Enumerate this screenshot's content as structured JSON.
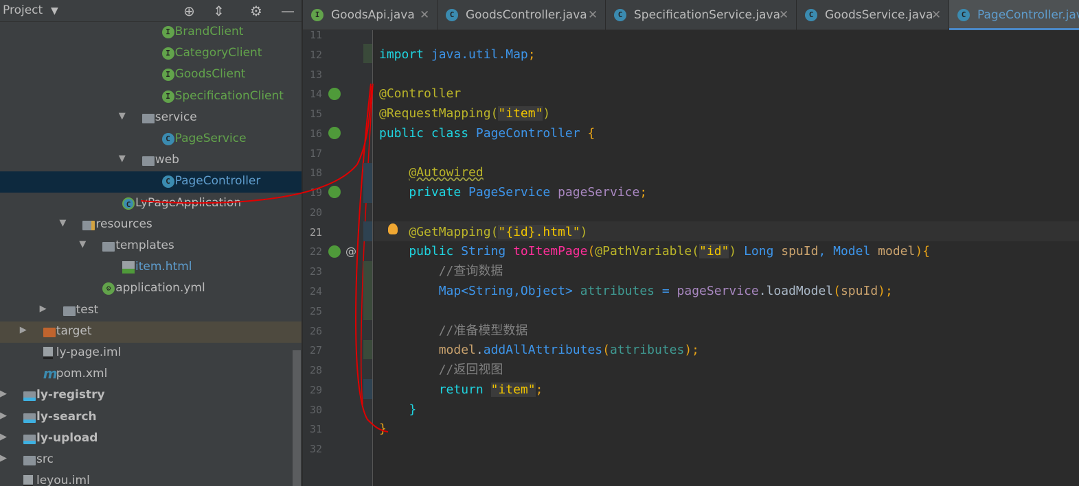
{
  "sidebar": {
    "title": "Project",
    "icons": [
      "locate-icon",
      "collapse-all-icon",
      "gear-icon",
      "minimize-icon"
    ],
    "items": [
      {
        "label": "BrandClient",
        "level": 7,
        "icon": "interface",
        "color": "green"
      },
      {
        "label": "CategoryClient",
        "level": 7,
        "icon": "interface",
        "color": "green"
      },
      {
        "label": "GoodsClient",
        "level": 7,
        "icon": "interface",
        "color": "green"
      },
      {
        "label": "SpecificationClient",
        "level": 7,
        "icon": "interface",
        "color": "green"
      },
      {
        "label": "service",
        "level": 6,
        "icon": "package",
        "arrow": "down"
      },
      {
        "label": "PageService",
        "level": 7,
        "icon": "class",
        "color": "green"
      },
      {
        "label": "web",
        "level": 6,
        "icon": "package",
        "arrow": "down"
      },
      {
        "label": "PageController",
        "level": 7,
        "icon": "class",
        "color": "blue",
        "selected": true
      },
      {
        "label": "LyPageApplication",
        "level": 5,
        "icon": "spring-boot-class"
      },
      {
        "label": "resources",
        "level": 3,
        "icon": "resources-folder",
        "arrow": "down"
      },
      {
        "label": "templates",
        "level": 4,
        "icon": "folder",
        "arrow": "down"
      },
      {
        "label": "item.html",
        "level": 5,
        "icon": "html-file",
        "color": "blue"
      },
      {
        "label": "application.yml",
        "level": 4,
        "icon": "spring-config"
      },
      {
        "label": "test",
        "level": 2,
        "icon": "folder",
        "arrow": "right"
      },
      {
        "label": "target",
        "level": 1,
        "icon": "excluded-folder",
        "arrow": "right",
        "highlight": true
      },
      {
        "label": "ly-page.iml",
        "level": 1,
        "icon": "iml-file"
      },
      {
        "label": "pom.xml",
        "level": 1,
        "icon": "maven"
      },
      {
        "label": "ly-registry",
        "level": 0,
        "icon": "module",
        "arrow": "right",
        "bold": true
      },
      {
        "label": "ly-search",
        "level": 0,
        "icon": "module",
        "arrow": "right",
        "bold": true
      },
      {
        "label": "ly-upload",
        "level": 0,
        "icon": "module",
        "arrow": "right",
        "bold": true
      },
      {
        "label": "src",
        "level": 0,
        "icon": "folder",
        "arrow": "right"
      },
      {
        "label": "leyou.iml",
        "level": 0,
        "icon": "iml-file"
      }
    ]
  },
  "tabs": [
    {
      "label": "GoodsApi.java",
      "icon": "interface"
    },
    {
      "label": "GoodsController.java",
      "icon": "class"
    },
    {
      "label": "SpecificationService.java",
      "icon": "class"
    },
    {
      "label": "GoodsService.java",
      "icon": "class"
    },
    {
      "label": "PageController.java",
      "icon": "class",
      "active": true
    }
  ],
  "editor": {
    "current_line": 21,
    "lines": [
      {
        "n": 11,
        "t": []
      },
      {
        "n": 12,
        "t": [
          [
            "import ",
            "kw"
          ],
          [
            "java.util.Map",
            "ty"
          ],
          [
            ";",
            "br"
          ]
        ]
      },
      {
        "n": 13,
        "t": []
      },
      {
        "n": 14,
        "t": [
          [
            "@Controller",
            "an"
          ]
        ]
      },
      {
        "n": 15,
        "t": [
          [
            "@RequestMapping(",
            "an"
          ],
          [
            "\"item\"",
            "st"
          ],
          [
            ")",
            "an"
          ]
        ]
      },
      {
        "n": 16,
        "t": [
          [
            "public class ",
            "kw"
          ],
          [
            "PageController ",
            "ty"
          ],
          [
            "{",
            "br"
          ]
        ]
      },
      {
        "n": 17,
        "t": []
      },
      {
        "n": 18,
        "t": [
          [
            "    ",
            ""
          ],
          [
            "@Autowired",
            "an ul"
          ]
        ]
      },
      {
        "n": 19,
        "t": [
          [
            "    private ",
            "kw"
          ],
          [
            "PageService ",
            "ty"
          ],
          [
            "pageService",
            "fd"
          ],
          [
            ";",
            "br"
          ]
        ]
      },
      {
        "n": 20,
        "t": []
      },
      {
        "n": 21,
        "t": [
          [
            "    ",
            ""
          ],
          [
            "@GetMapping(",
            "an"
          ],
          [
            "\"{id}.html\"",
            "st"
          ],
          [
            ")",
            "an"
          ]
        ]
      },
      {
        "n": 22,
        "t": [
          [
            "    public ",
            "kw"
          ],
          [
            "String ",
            "ty"
          ],
          [
            "toItemPage",
            "mt"
          ],
          [
            "(",
            "br"
          ],
          [
            "@PathVariable(",
            "an"
          ],
          [
            "\"id\"",
            "st"
          ],
          [
            ") ",
            "an"
          ],
          [
            "Long ",
            "ty"
          ],
          [
            "spuId",
            "pr"
          ],
          [
            ", ",
            "ty"
          ],
          [
            "Model ",
            "ty"
          ],
          [
            "model",
            "pr"
          ],
          [
            "){",
            "br"
          ]
        ]
      },
      {
        "n": 23,
        "t": [
          [
            "        //查询数据",
            "cm"
          ]
        ]
      },
      {
        "n": 24,
        "t": [
          [
            "        Map<",
            "ty"
          ],
          [
            "String,Object",
            "ty"
          ],
          [
            "> ",
            "ty"
          ],
          [
            "attributes ",
            "lv"
          ],
          [
            "= ",
            "ty"
          ],
          [
            "pageService",
            "fd"
          ],
          [
            ".loadModel",
            "pl"
          ],
          [
            "(",
            "br"
          ],
          [
            "spuId",
            "pr"
          ],
          [
            ");",
            "br"
          ]
        ]
      },
      {
        "n": 25,
        "t": []
      },
      {
        "n": 26,
        "t": [
          [
            "        //准备模型数据",
            "cm"
          ]
        ]
      },
      {
        "n": 27,
        "t": [
          [
            "        model",
            "pr"
          ],
          [
            ".",
            "pl"
          ],
          [
            "addAllAttributes",
            "ty"
          ],
          [
            "(",
            "br"
          ],
          [
            "attributes",
            "lv"
          ],
          [
            ");",
            "br"
          ]
        ]
      },
      {
        "n": 28,
        "t": [
          [
            "        //返回视图",
            "cm"
          ]
        ]
      },
      {
        "n": 29,
        "t": [
          [
            "        return ",
            "kw"
          ],
          [
            "\"item\"",
            "st"
          ],
          [
            ";",
            "br"
          ]
        ]
      },
      {
        "n": 30,
        "t": [
          [
            "    }",
            "kw"
          ]
        ]
      },
      {
        "n": 31,
        "t": [
          [
            "}",
            "br"
          ]
        ]
      },
      {
        "n": 32,
        "t": []
      }
    ]
  },
  "colors": {
    "annotation_marks": "#e00000",
    "accent": "#4a88c7"
  }
}
